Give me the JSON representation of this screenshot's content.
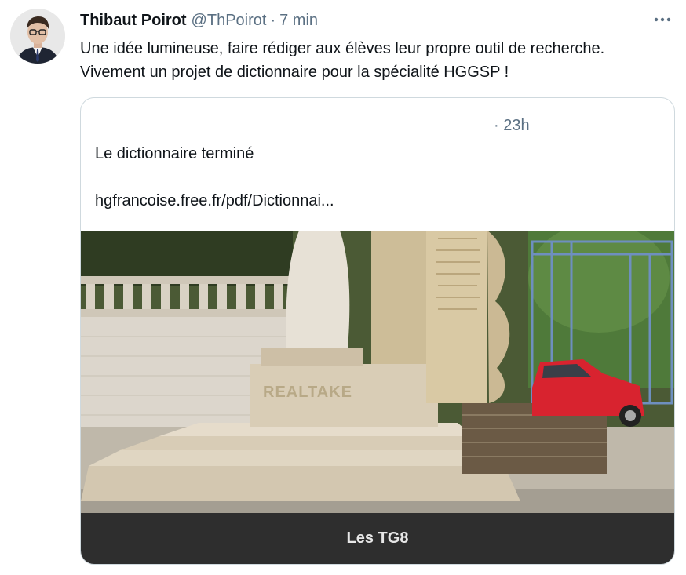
{
  "tweet": {
    "author_name": "Thibaut Poirot",
    "author_handle": "@ThPoirot",
    "separator": "·",
    "timestamp": "7 min",
    "more_label": "···",
    "text_lines": [
      "Une idée lumineuse, faire rédiger aux élèves leur propre outil de recherche.",
      "Vivement un projet de dictionnaire pour la spécialité HGGSP !"
    ]
  },
  "quote": {
    "timestamp": "· 23h",
    "text": "Le dictionnaire terminé",
    "link": "hgfrancoise.free.fr/pdf/Dictionnai...",
    "image_alt": "monument-photo",
    "monument_inscription": "REALTAKE",
    "caption": "Les TG8"
  },
  "colors": {
    "text_primary": "#0f1419",
    "text_secondary": "#5b7083",
    "border": "#cfd9de",
    "caption_bg": "#2e2e2e",
    "car": "#d8232f"
  }
}
